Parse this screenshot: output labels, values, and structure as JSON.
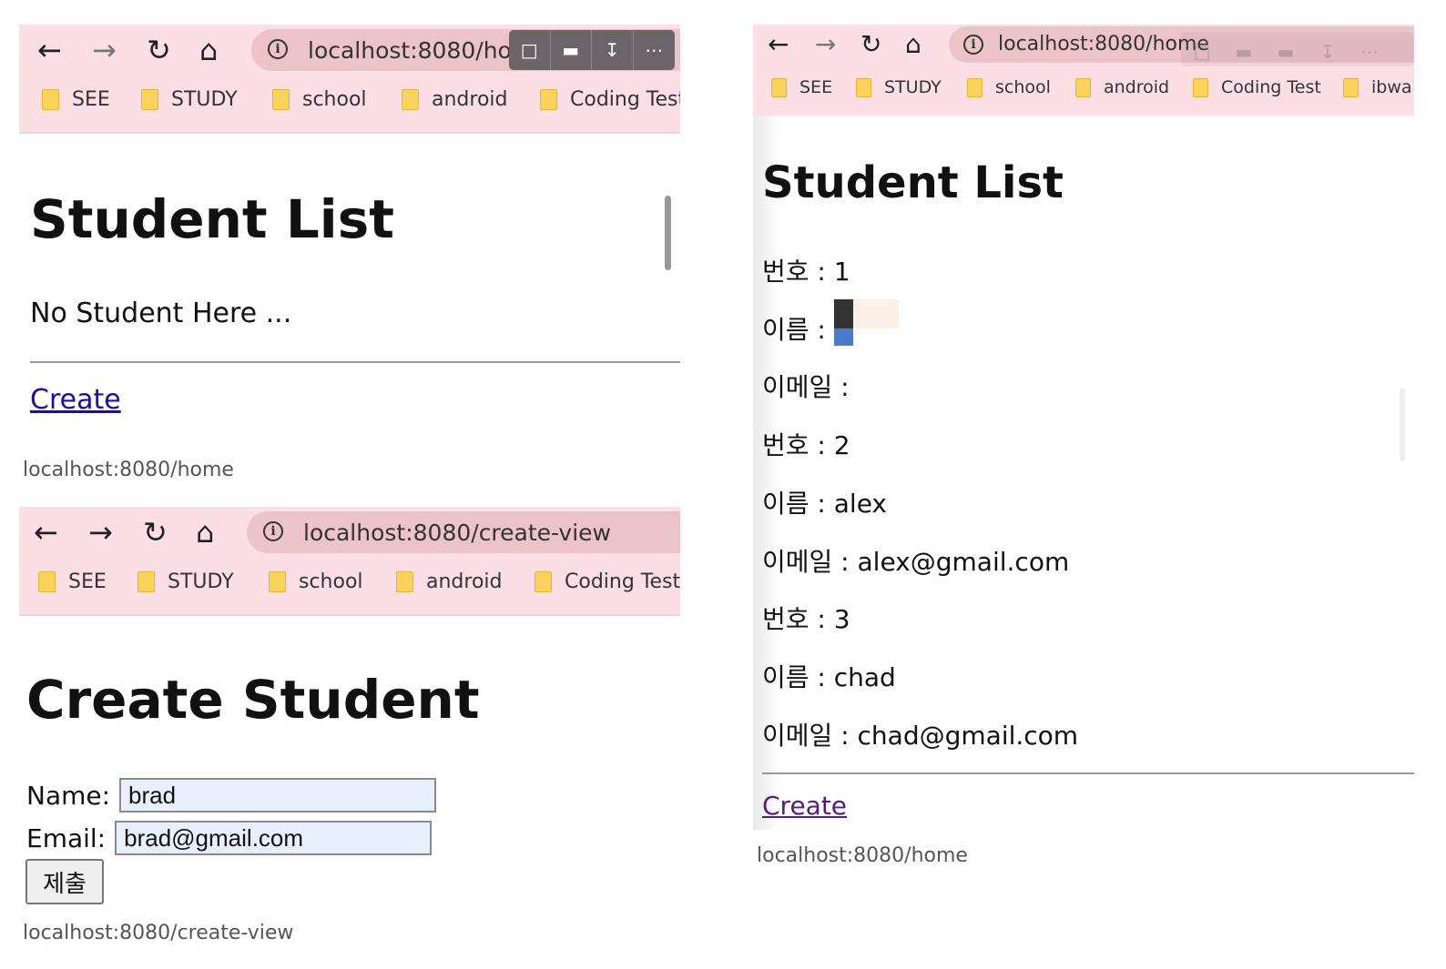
{
  "common": {
    "bookmarks": [
      "SEE",
      "STUDY",
      "school",
      "android",
      "Coding Test",
      "ibwa"
    ]
  },
  "panel_home_empty": {
    "url": "localhost:8080/home",
    "title": "Student List",
    "empty_message": "No Student Here ...",
    "create_link": "Create",
    "caption": "localhost:8080/home"
  },
  "panel_create": {
    "url": "localhost:8080/create-view",
    "title": "Create Student",
    "name_label": "Name:",
    "name_value": "brad",
    "email_label": "Email:",
    "email_value": "brad@gmail.com",
    "submit_label": "제출",
    "caption": "localhost:8080/create-view"
  },
  "panel_home_list": {
    "url": "localhost:8080/home",
    "title": "Student List",
    "students": [
      {
        "no_label": "번호 : 1",
        "name_label": "이름 : ",
        "email_label": "이메일 : "
      },
      {
        "no_label": "번호 : 2",
        "name_label": "이름 : alex",
        "email_label": "이메일 : alex@gmail.com"
      },
      {
        "no_label": "번호 : 3",
        "name_label": "이름 : chad",
        "email_label": "이메일 : chad@gmail.com"
      }
    ],
    "create_link": "Create",
    "caption": "localhost:8080/home"
  },
  "colors": {
    "toolbar_bg": "#fcdfe4",
    "address_bg": "#ecc3c9",
    "link": "#1a0dab",
    "visited_link": "#551a8b",
    "input_bg": "#e8f0fe"
  },
  "icons": [
    "back-arrow-icon",
    "forward-arrow-icon",
    "reload-icon",
    "home-icon",
    "info-icon",
    "folder-icon",
    "comment-icon",
    "tablet-icon",
    "download-icon",
    "more-icon"
  ]
}
